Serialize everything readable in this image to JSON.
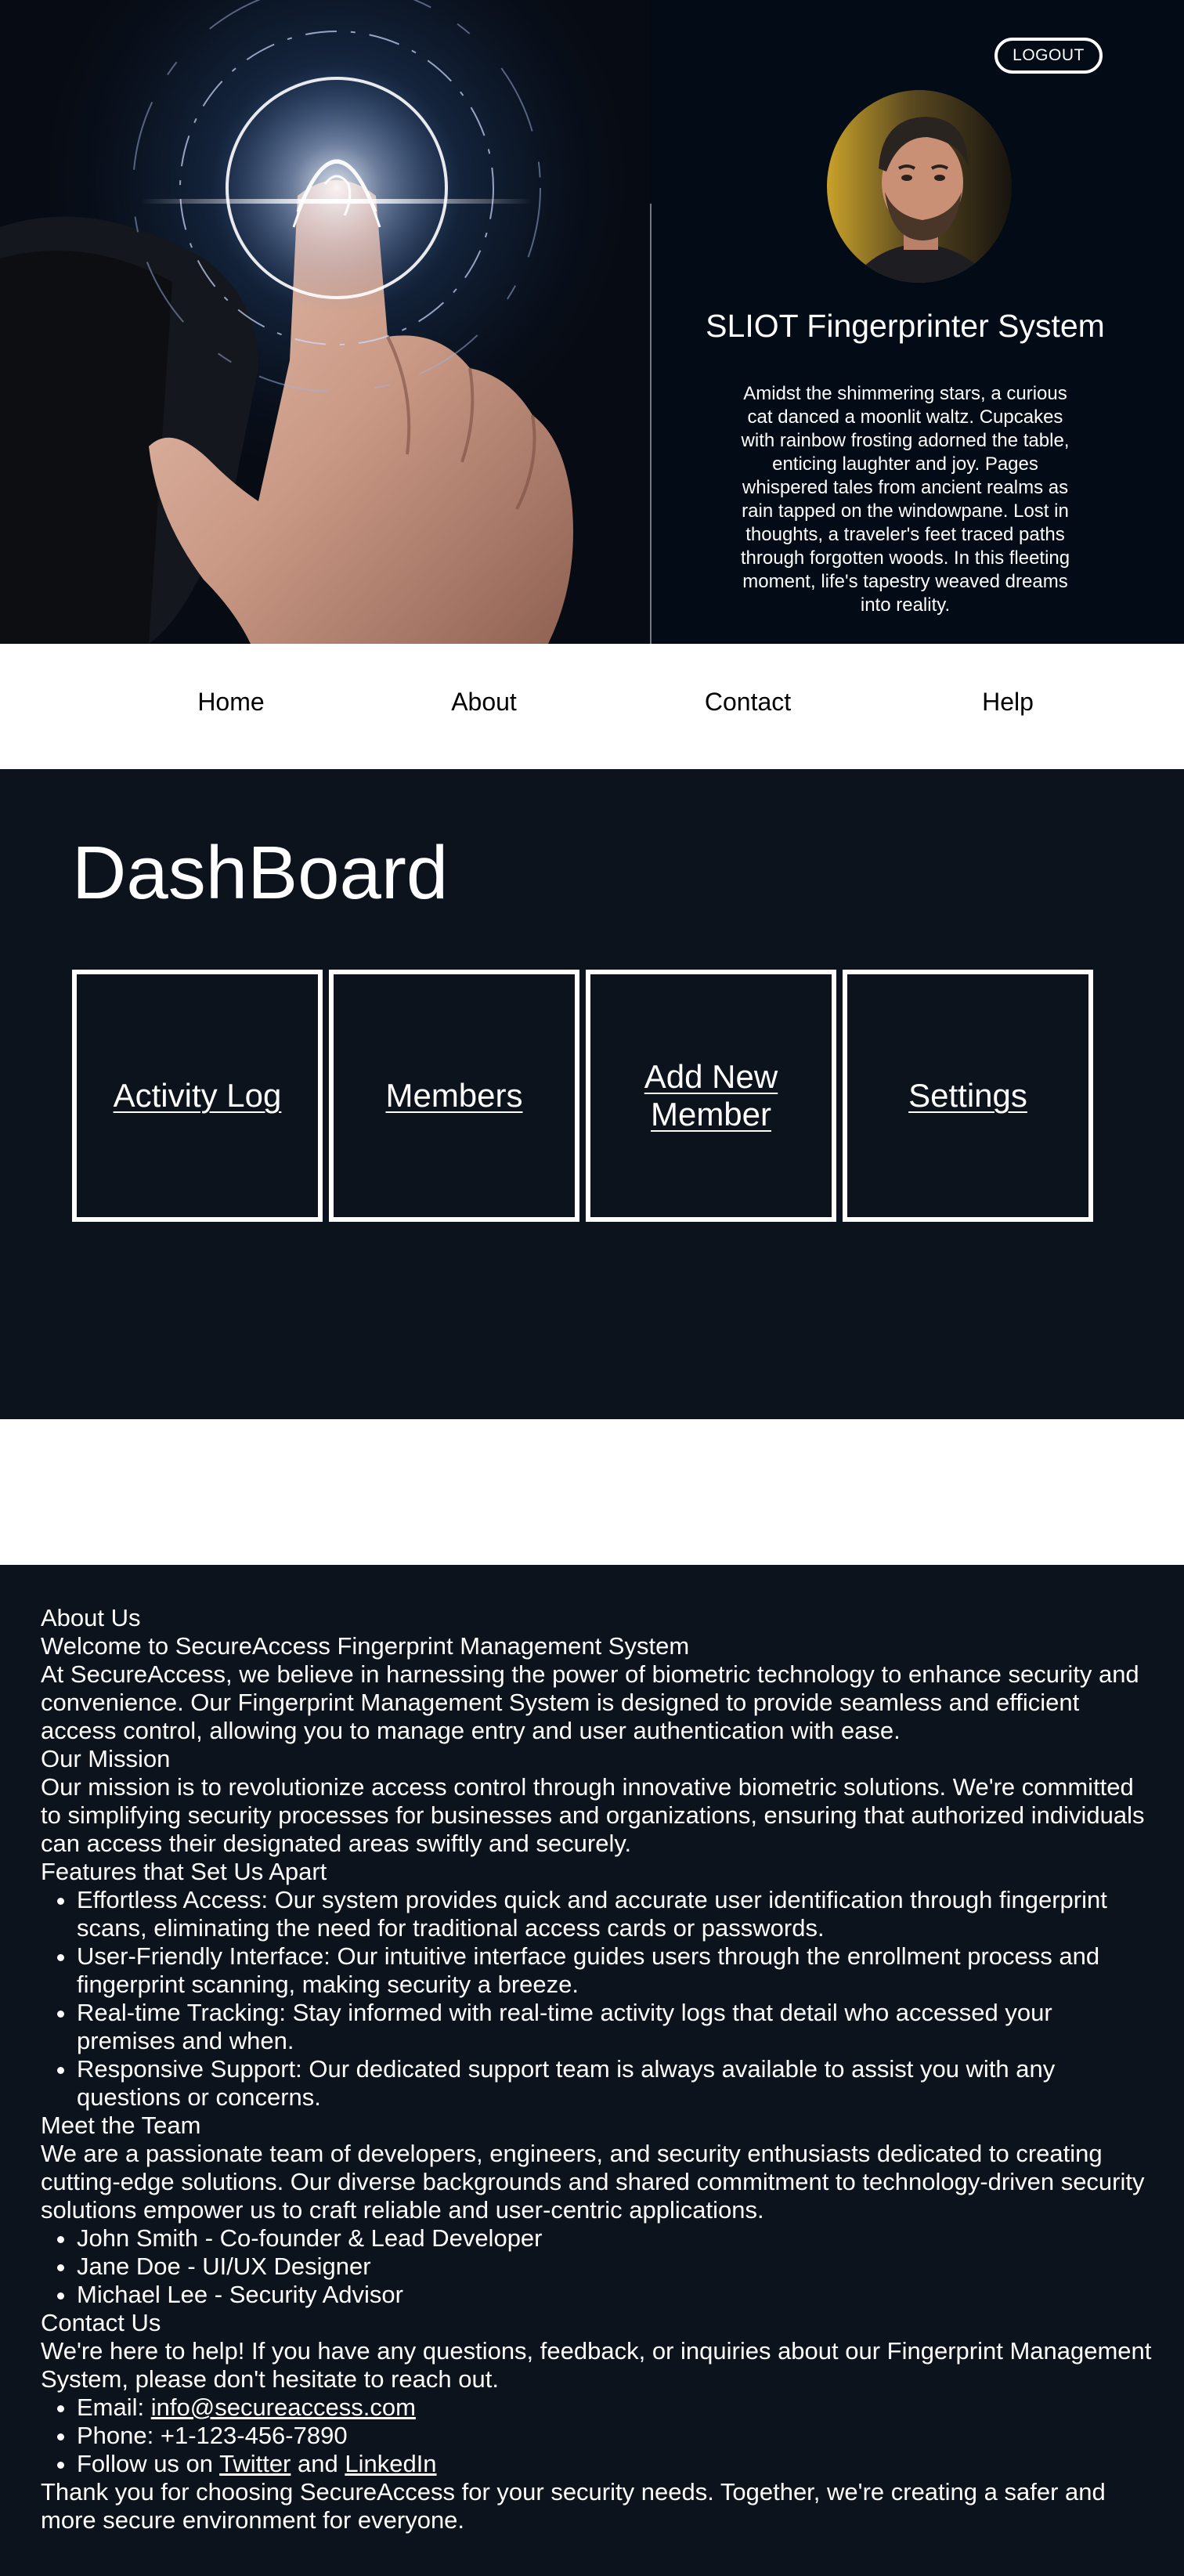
{
  "header": {
    "logout_label": "LOGOUT",
    "title": "SLIOT Fingerprinter System",
    "description": "Amidst the shimmering stars, a curious cat danced a moonlit waltz. Cupcakes with rainbow frosting adorned the table, enticing laughter and joy. Pages whispered tales from ancient realms as rain tapped on the windowpane. Lost in thoughts, a traveler's feet traced paths through forgotten woods. In this fleeting moment, life's tapestry weaved dreams into reality."
  },
  "nav": {
    "items": [
      {
        "label": "Home"
      },
      {
        "label": "About"
      },
      {
        "label": "Contact"
      },
      {
        "label": "Help"
      }
    ]
  },
  "dashboard": {
    "title": "DashBoard",
    "cards": [
      {
        "label": "Activity Log"
      },
      {
        "label": "Members"
      },
      {
        "label": "Add New Member"
      },
      {
        "label": "Settings"
      }
    ]
  },
  "about": {
    "heading": "About Us",
    "subheading": "Welcome to SecureAccess Fingerprint Management System",
    "intro": "At SecureAccess, we believe in harnessing the power of biometric technology to enhance security and convenience. Our Fingerprint Management System is designed to provide seamless and efficient access control, allowing you to manage entry and user authentication with ease.",
    "mission_heading": "Our Mission",
    "mission_text": "Our mission is to revolutionize access control through innovative biometric solutions. We're committed to simplifying security processes for businesses and organizations, ensuring that authorized individuals can access their designated areas swiftly and securely.",
    "features_heading": "Features that Set Us Apart",
    "features": [
      "Effortless Access: Our system provides quick and accurate user identification through fingerprint scans, eliminating the need for traditional access cards or passwords.",
      "User-Friendly Interface: Our intuitive interface guides users through the enrollment process and fingerprint scanning, making security a breeze.",
      "Real-time Tracking: Stay informed with real-time activity logs that detail who accessed your premises and when.",
      "Responsive Support: Our dedicated support team is always available to assist you with any questions or concerns."
    ],
    "team_heading": "Meet the Team",
    "team_text": "We are a passionate team of developers, engineers, and security enthusiasts dedicated to creating cutting-edge solutions. Our diverse backgrounds and shared commitment to technology-driven security solutions empower us to craft reliable and user-centric applications.",
    "team": [
      "John Smith - Co-founder & Lead Developer",
      "Jane Doe - UI/UX Designer",
      "Michael Lee - Security Advisor"
    ],
    "contact_heading": "Contact Us",
    "contact_text": "We're here to help! If you have any questions, feedback, or inquiries about our Fingerprint Management System, please don't hesitate to reach out.",
    "email_prefix": "Email: ",
    "email": "info@secureaccess.com",
    "phone": "Phone: +1-123-456-7890",
    "follow_prefix": "Follow us on ",
    "twitter": "Twitter",
    "and": " and ",
    "linkedin": "LinkedIn",
    "closing": "Thank you for choosing SecureAccess for your security needs. Together, we're creating a safer and more secure environment for everyone."
  },
  "colors": {
    "dark_bg": "#0d131c",
    "hero_bg": "#030b17",
    "text_light": "#ffffff",
    "nav_text": "#000000"
  },
  "icons": {
    "hero_image": "fingerprint-touch-image",
    "avatar": "user-avatar"
  }
}
